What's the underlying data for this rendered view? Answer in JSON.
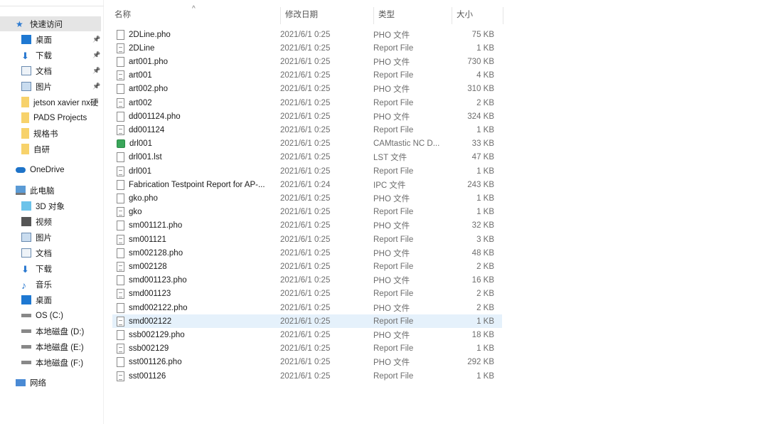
{
  "sidebar": {
    "quick_access": "快速访问",
    "quick": [
      {
        "label": "桌面",
        "icon": "desktop-icon",
        "pinned": true
      },
      {
        "label": "下载",
        "icon": "download-icon",
        "pinned": true
      },
      {
        "label": "文档",
        "icon": "document-icon",
        "pinned": true
      },
      {
        "label": "图片",
        "icon": "pictures-icon",
        "pinned": true
      },
      {
        "label": "jetson xavier nx硬",
        "icon": "folder-icon"
      },
      {
        "label": "PADS Projects",
        "icon": "folder-icon"
      },
      {
        "label": "规格书",
        "icon": "folder-icon"
      },
      {
        "label": "自研",
        "icon": "folder-icon"
      }
    ],
    "onedrive": "OneDrive",
    "this_pc": "此电脑",
    "pc": [
      {
        "label": "3D 对象",
        "icon": "3d-objects-icon"
      },
      {
        "label": "视频",
        "icon": "video-icon"
      },
      {
        "label": "图片",
        "icon": "pictures-icon"
      },
      {
        "label": "文档",
        "icon": "document-icon"
      },
      {
        "label": "下载",
        "icon": "download-icon"
      },
      {
        "label": "音乐",
        "icon": "music-icon"
      },
      {
        "label": "桌面",
        "icon": "desktop-icon"
      },
      {
        "label": "OS (C:)",
        "icon": "drive-icon"
      },
      {
        "label": "本地磁盘 (D:)",
        "icon": "drive-icon"
      },
      {
        "label": "本地磁盘 (E:)",
        "icon": "drive-icon"
      },
      {
        "label": "本地磁盘 (F:)",
        "icon": "drive-icon"
      }
    ],
    "network": "网络"
  },
  "columns": {
    "name": "名称",
    "date": "修改日期",
    "type": "类型",
    "size": "大小"
  },
  "files": [
    {
      "name": "2DLine.pho",
      "date": "2021/6/1 0:25",
      "type": "PHO 文件",
      "size": "75 KB",
      "kind": "blank"
    },
    {
      "name": "2DLine",
      "date": "2021/6/1 0:25",
      "type": "Report File",
      "size": "1 KB",
      "kind": "rep"
    },
    {
      "name": "art001.pho",
      "date": "2021/6/1 0:25",
      "type": "PHO 文件",
      "size": "730 KB",
      "kind": "blank"
    },
    {
      "name": "art001",
      "date": "2021/6/1 0:25",
      "type": "Report File",
      "size": "4 KB",
      "kind": "rep"
    },
    {
      "name": "art002.pho",
      "date": "2021/6/1 0:25",
      "type": "PHO 文件",
      "size": "310 KB",
      "kind": "blank"
    },
    {
      "name": "art002",
      "date": "2021/6/1 0:25",
      "type": "Report File",
      "size": "2 KB",
      "kind": "rep"
    },
    {
      "name": "dd001124.pho",
      "date": "2021/6/1 0:25",
      "type": "PHO 文件",
      "size": "324 KB",
      "kind": "blank"
    },
    {
      "name": "dd001124",
      "date": "2021/6/1 0:25",
      "type": "Report File",
      "size": "1 KB",
      "kind": "rep"
    },
    {
      "name": "drl001",
      "date": "2021/6/1 0:25",
      "type": "CAMtastic NC D...",
      "size": "33 KB",
      "kind": "cam"
    },
    {
      "name": "drl001.lst",
      "date": "2021/6/1 0:25",
      "type": "LST 文件",
      "size": "47 KB",
      "kind": "blank"
    },
    {
      "name": "drl001",
      "date": "2021/6/1 0:25",
      "type": "Report File",
      "size": "1 KB",
      "kind": "rep"
    },
    {
      "name": "Fabrication Testpoint Report for AP-...",
      "date": "2021/6/1 0:24",
      "type": "IPC 文件",
      "size": "243 KB",
      "kind": "blank"
    },
    {
      "name": "gko.pho",
      "date": "2021/6/1 0:25",
      "type": "PHO 文件",
      "size": "1 KB",
      "kind": "blank"
    },
    {
      "name": "gko",
      "date": "2021/6/1 0:25",
      "type": "Report File",
      "size": "1 KB",
      "kind": "rep"
    },
    {
      "name": "sm001121.pho",
      "date": "2021/6/1 0:25",
      "type": "PHO 文件",
      "size": "32 KB",
      "kind": "blank"
    },
    {
      "name": "sm001121",
      "date": "2021/6/1 0:25",
      "type": "Report File",
      "size": "3 KB",
      "kind": "rep"
    },
    {
      "name": "sm002128.pho",
      "date": "2021/6/1 0:25",
      "type": "PHO 文件",
      "size": "48 KB",
      "kind": "blank"
    },
    {
      "name": "sm002128",
      "date": "2021/6/1 0:25",
      "type": "Report File",
      "size": "2 KB",
      "kind": "rep"
    },
    {
      "name": "smd001123.pho",
      "date": "2021/6/1 0:25",
      "type": "PHO 文件",
      "size": "16 KB",
      "kind": "blank"
    },
    {
      "name": "smd001123",
      "date": "2021/6/1 0:25",
      "type": "Report File",
      "size": "2 KB",
      "kind": "rep"
    },
    {
      "name": "smd002122.pho",
      "date": "2021/6/1 0:25",
      "type": "PHO 文件",
      "size": "2 KB",
      "kind": "blank"
    },
    {
      "name": "smd002122",
      "date": "2021/6/1 0:25",
      "type": "Report File",
      "size": "1 KB",
      "kind": "rep",
      "selected": true
    },
    {
      "name": "ssb002129.pho",
      "date": "2021/6/1 0:25",
      "type": "PHO 文件",
      "size": "18 KB",
      "kind": "blank"
    },
    {
      "name": "ssb002129",
      "date": "2021/6/1 0:25",
      "type": "Report File",
      "size": "1 KB",
      "kind": "rep"
    },
    {
      "name": "sst001126.pho",
      "date": "2021/6/1 0:25",
      "type": "PHO 文件",
      "size": "292 KB",
      "kind": "blank"
    },
    {
      "name": "sst001126",
      "date": "2021/6/1 0:25",
      "type": "Report File",
      "size": "1 KB",
      "kind": "rep"
    }
  ]
}
